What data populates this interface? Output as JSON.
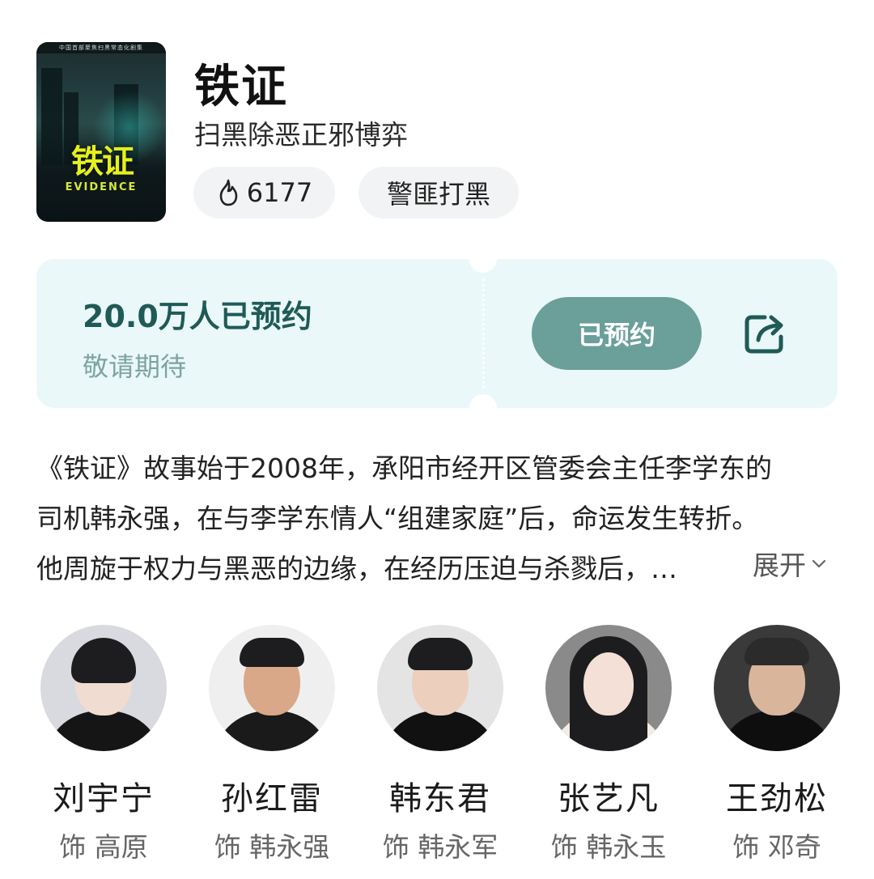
{
  "show": {
    "title": "铁证",
    "subtitle": "扫黑除恶正邪博弈",
    "heat": "6177",
    "tag": "警匪打黑",
    "poster": {
      "top_text": "中国首部聚焦扫黑常态化剧集",
      "title": "铁证",
      "english_title": "EVIDENCE"
    }
  },
  "reservation": {
    "count_text": "20.0万人已预约",
    "hint": "敬请期待",
    "button_label": "已预约"
  },
  "description": {
    "lines": [
      "《铁证》故事始于2008年，承阳市经开区管委会主任李学东的",
      "司机韩永强，在与李学东情人“组建家庭”后，命运发生转折。",
      "他周旋于权力与黑恶的边缘，在经历压迫与杀戮后，…"
    ],
    "expand_label": "展开"
  },
  "cast": [
    {
      "name": "刘宇宁",
      "role": "饰 高原"
    },
    {
      "name": "孙红雷",
      "role": "饰 韩永强"
    },
    {
      "name": "韩东君",
      "role": "饰 韩永军"
    },
    {
      "name": "张艺凡",
      "role": "饰 韩永玉"
    },
    {
      "name": "王劲松",
      "role": "饰 邓奇"
    }
  ],
  "colors": {
    "card_bg": "#eaf8f9",
    "accent": "#1f5a56",
    "button_bg": "#6a9f9a",
    "muted_teal": "#7da4a2"
  },
  "icons": {
    "heat": "flame-icon",
    "share": "share-icon",
    "expand": "chevron-down-icon"
  }
}
